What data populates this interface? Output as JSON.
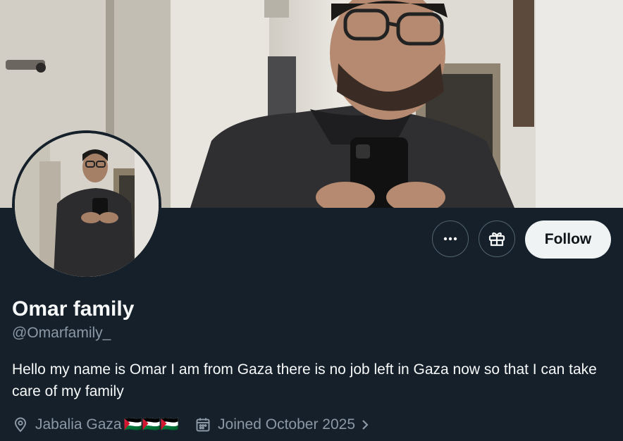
{
  "profile": {
    "name": "Omar family",
    "handle": "@Omarfamily_",
    "bio": "Hello my name is Omar I am from Gaza there is no job left in Gaza now so that I can take care of my family",
    "location": "Jabalia Gaza",
    "location_flags": "🇵🇸🇵🇸🇵🇸",
    "joined": "Joined October 2025"
  },
  "actions": {
    "more_icon": "more-horizontal-icon",
    "subscribe_icon": "gift-icon",
    "follow_label": "Follow"
  },
  "colors": {
    "background": "#15202b",
    "secondary_text": "#8b98a5",
    "follow_button_bg": "#eff3f4",
    "button_border": "#536471"
  }
}
